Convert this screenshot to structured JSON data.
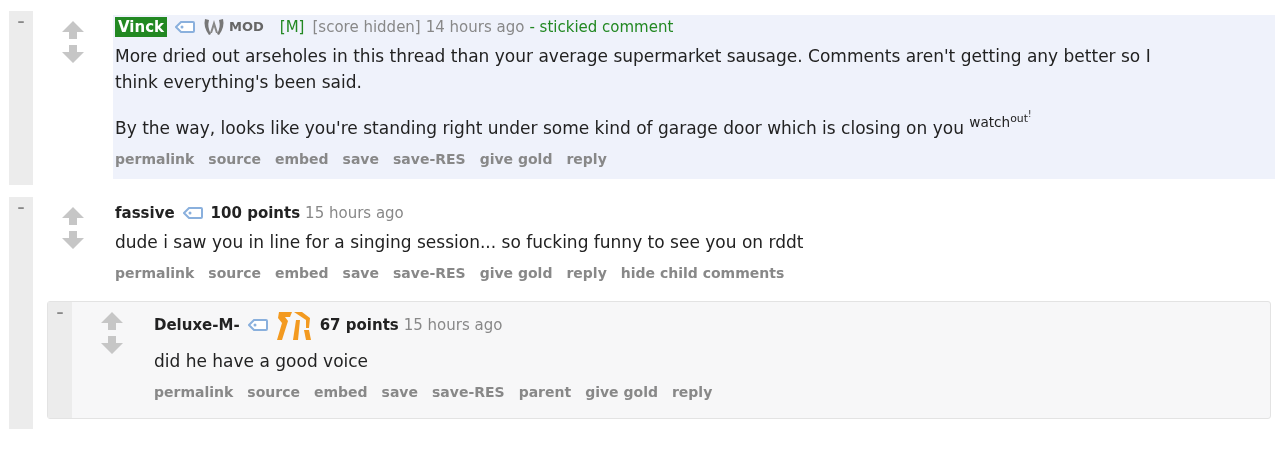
{
  "comments": [
    {
      "collapse": "–",
      "author": "Vinck",
      "moderator": true,
      "mod_badge": "MOD",
      "distinguished": "[M]",
      "score": "[score hidden]",
      "score_hidden": true,
      "time": "14 hours ago",
      "note": "- stickied comment",
      "stickied": true,
      "team_flair": false,
      "paragraphs": [
        {
          "text": "More dried out arseholes in this thread than your average supermarket sausage. Comments aren't getting any better so I think everything's been said."
        },
        {
          "text": "By the way, looks like you're standing right under some kind of garage door which is closing on you",
          "raised": {
            "text": "watch",
            "raised": {
              "text": "out",
              "raised": {
                "text": "!"
              }
            }
          }
        }
      ],
      "actions": [
        "permalink",
        "source",
        "embed",
        "save",
        "save-RES",
        "give gold",
        "reply"
      ]
    },
    {
      "collapse": "–",
      "author": "fassive",
      "moderator": false,
      "score": "100 points",
      "score_hidden": false,
      "time": "15 hours ago",
      "stickied": false,
      "team_flair": false,
      "paragraphs": [
        {
          "text": "dude i saw you in line for a singing session... so fucking funny to see you on rddt"
        }
      ],
      "actions": [
        "permalink",
        "source",
        "embed",
        "save",
        "save-RES",
        "give gold",
        "reply",
        "hide child comments"
      ],
      "children": [
        {
          "collapse": "–",
          "author": "Deluxe-M-",
          "moderator": false,
          "score": "67 points",
          "score_hidden": false,
          "time": "15 hours ago",
          "team_flair": true,
          "paragraphs": [
            {
              "text": "did he have a good voice"
            }
          ],
          "actions": [
            "permalink",
            "source",
            "embed",
            "save",
            "save-RES",
            "parent",
            "give gold",
            "reply"
          ]
        }
      ]
    }
  ]
}
